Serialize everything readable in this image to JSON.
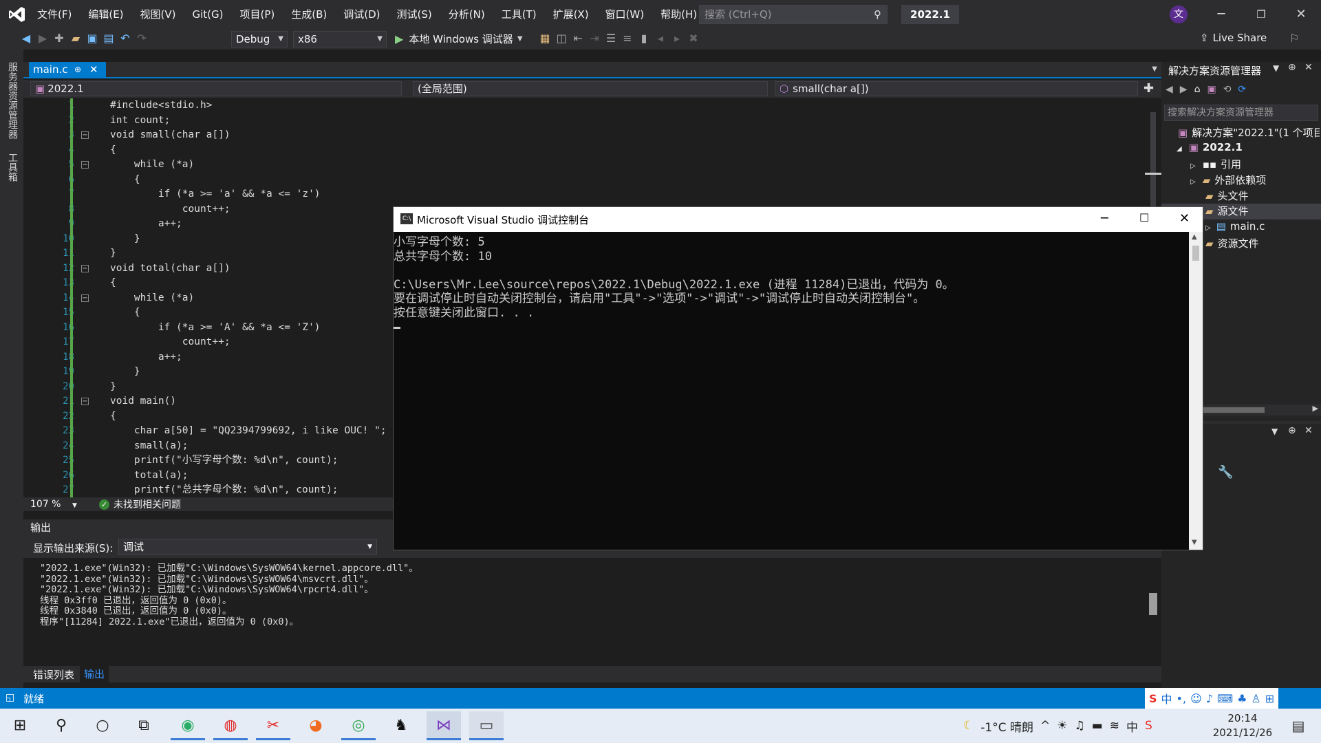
{
  "titlebar": {
    "menus": [
      "文件(F)",
      "编辑(E)",
      "视图(V)",
      "Git(G)",
      "项目(P)",
      "生成(B)",
      "调试(D)",
      "测试(S)",
      "分析(N)",
      "工具(T)",
      "扩展(X)",
      "窗口(W)",
      "帮助(H)"
    ],
    "search_placeholder": "搜索 (Ctrl+Q)",
    "solution_name": "2022.1",
    "user_initial": "文"
  },
  "toolbar": {
    "config": "Debug",
    "platform": "x86",
    "run_label": "本地 Windows 调试器",
    "live_share": "Live Share"
  },
  "left_strip": {
    "server_explorer": "服务器资源管理器",
    "toolbox": "工具箱"
  },
  "editor": {
    "tab_label": "main.c",
    "nav_project": "2022.1",
    "nav_scope": "(全局范围)",
    "nav_function": "small(char a[])",
    "zoom": "107 %",
    "issues": "未找到相关问题",
    "line_numbers": [
      "1",
      "2",
      "3",
      "4",
      "5",
      "6",
      "7",
      "8",
      "9",
      "10",
      "11",
      "12",
      "13",
      "14",
      "15",
      "16",
      "17",
      "18",
      "19",
      "20",
      "21",
      "22",
      "23",
      "24",
      "25",
      "26",
      "27"
    ],
    "code_lines": [
      "#include<stdio.h>",
      "int count;",
      "void small(char a[])",
      "{",
      "    while (*a)",
      "    {",
      "        if (*a >= 'a' && *a <= 'z')",
      "            count++;",
      "        a++;",
      "    }",
      "}",
      "void total(char a[])",
      "{",
      "    while (*a)",
      "    {",
      "        if (*a >= 'A' && *a <= 'Z')",
      "            count++;",
      "        a++;",
      "    }",
      "}",
      "void main()",
      "{",
      "    char a[50] = \"QQ2394799692, i like OUC! \";",
      "    small(a);",
      "    printf(\"小写字母个数: %d\\n\", count);",
      "    total(a);",
      "    printf(\"总共字母个数: %d\\n\", count);"
    ]
  },
  "output": {
    "header": "输出",
    "source_label": "显示输出来源(S):",
    "source_value": "调试",
    "lines": [
      "\"2022.1.exe\"(Win32): 已加载\"C:\\Windows\\SysWOW64\\kernel.appcore.dll\"。",
      "\"2022.1.exe\"(Win32): 已加载\"C:\\Windows\\SysWOW64\\msvcrt.dll\"。",
      "\"2022.1.exe\"(Win32): 已加载\"C:\\Windows\\SysWOW64\\rpcrt4.dll\"。",
      "线程 0x3ff0 已退出，返回值为 0 (0x0)。",
      "线程 0x3840 已退出，返回值为 0 (0x0)。",
      "程序\"[11284] 2022.1.exe\"已退出，返回值为 0 (0x0)。"
    ],
    "tab_errors": "错误列表",
    "tab_output": "输出"
  },
  "solution_explorer": {
    "title": "解决方案资源管理器",
    "search_placeholder": "搜索解决方案资源管理器",
    "solution_label": "解决方案\"2022.1\"(1 个项目",
    "project": "2022.1",
    "items": [
      "引用",
      "外部依赖项",
      "头文件",
      "源文件",
      "main.c",
      "资源文件"
    ]
  },
  "console": {
    "title": "Microsoft Visual Studio 调试控制台",
    "lines": [
      "小写字母个数: 5",
      "总共字母个数: 10",
      "",
      "C:\\Users\\Mr.Lee\\source\\repos\\2022.1\\Debug\\2022.1.exe (进程 11284)已退出，代码为 0。",
      "要在调试停止时自动关闭控制台，请启用\"工具\"->\"选项\"->\"调试\"->\"调试停止时自动关闭控制台\"。",
      "按任意键关闭此窗口. . ."
    ]
  },
  "statusbar": {
    "ready": "就绪"
  },
  "taskbar": {
    "weather": "-1°C  晴朗",
    "ime": "中",
    "time": "20:14",
    "date": "2021/12/26"
  }
}
